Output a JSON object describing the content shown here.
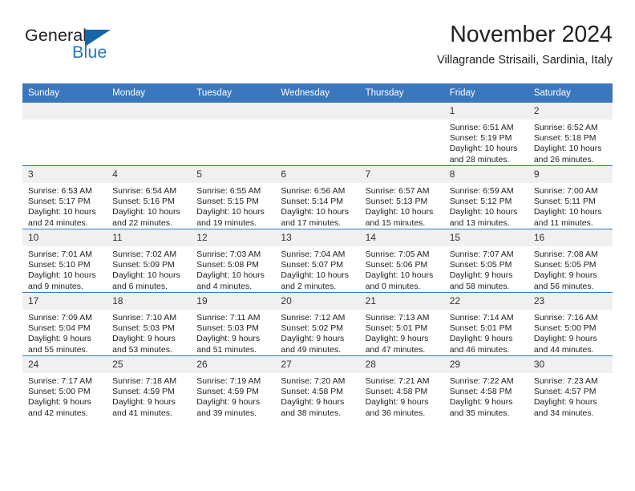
{
  "brand": {
    "name_top": "General",
    "name_bottom": "Blue",
    "color_dark": "#231f20",
    "color_blue": "#2878bd",
    "flag_color": "#1565a8"
  },
  "header": {
    "title": "November 2024",
    "subtitle": "Villagrande Strisaili, Sardinia, Italy"
  },
  "theme": {
    "header_blue": "#3b77bc",
    "daynum_bg": "#f0f0f0",
    "text": "#222222"
  },
  "calendar": {
    "weekday_headers": [
      "Sunday",
      "Monday",
      "Tuesday",
      "Wednesday",
      "Thursday",
      "Friday",
      "Saturday"
    ],
    "weeks": [
      [
        {
          "day": "",
          "blank": true
        },
        {
          "day": "",
          "blank": true
        },
        {
          "day": "",
          "blank": true
        },
        {
          "day": "",
          "blank": true
        },
        {
          "day": "",
          "blank": true
        },
        {
          "day": "1",
          "sunrise": "Sunrise: 6:51 AM",
          "sunset": "Sunset: 5:19 PM",
          "daylight": "Daylight: 10 hours and 28 minutes."
        },
        {
          "day": "2",
          "sunrise": "Sunrise: 6:52 AM",
          "sunset": "Sunset: 5:18 PM",
          "daylight": "Daylight: 10 hours and 26 minutes."
        }
      ],
      [
        {
          "day": "3",
          "sunrise": "Sunrise: 6:53 AM",
          "sunset": "Sunset: 5:17 PM",
          "daylight": "Daylight: 10 hours and 24 minutes."
        },
        {
          "day": "4",
          "sunrise": "Sunrise: 6:54 AM",
          "sunset": "Sunset: 5:16 PM",
          "daylight": "Daylight: 10 hours and 22 minutes."
        },
        {
          "day": "5",
          "sunrise": "Sunrise: 6:55 AM",
          "sunset": "Sunset: 5:15 PM",
          "daylight": "Daylight: 10 hours and 19 minutes."
        },
        {
          "day": "6",
          "sunrise": "Sunrise: 6:56 AM",
          "sunset": "Sunset: 5:14 PM",
          "daylight": "Daylight: 10 hours and 17 minutes."
        },
        {
          "day": "7",
          "sunrise": "Sunrise: 6:57 AM",
          "sunset": "Sunset: 5:13 PM",
          "daylight": "Daylight: 10 hours and 15 minutes."
        },
        {
          "day": "8",
          "sunrise": "Sunrise: 6:59 AM",
          "sunset": "Sunset: 5:12 PM",
          "daylight": "Daylight: 10 hours and 13 minutes."
        },
        {
          "day": "9",
          "sunrise": "Sunrise: 7:00 AM",
          "sunset": "Sunset: 5:11 PM",
          "daylight": "Daylight: 10 hours and 11 minutes."
        }
      ],
      [
        {
          "day": "10",
          "sunrise": "Sunrise: 7:01 AM",
          "sunset": "Sunset: 5:10 PM",
          "daylight": "Daylight: 10 hours and 9 minutes."
        },
        {
          "day": "11",
          "sunrise": "Sunrise: 7:02 AM",
          "sunset": "Sunset: 5:09 PM",
          "daylight": "Daylight: 10 hours and 6 minutes."
        },
        {
          "day": "12",
          "sunrise": "Sunrise: 7:03 AM",
          "sunset": "Sunset: 5:08 PM",
          "daylight": "Daylight: 10 hours and 4 minutes."
        },
        {
          "day": "13",
          "sunrise": "Sunrise: 7:04 AM",
          "sunset": "Sunset: 5:07 PM",
          "daylight": "Daylight: 10 hours and 2 minutes."
        },
        {
          "day": "14",
          "sunrise": "Sunrise: 7:05 AM",
          "sunset": "Sunset: 5:06 PM",
          "daylight": "Daylight: 10 hours and 0 minutes."
        },
        {
          "day": "15",
          "sunrise": "Sunrise: 7:07 AM",
          "sunset": "Sunset: 5:05 PM",
          "daylight": "Daylight: 9 hours and 58 minutes."
        },
        {
          "day": "16",
          "sunrise": "Sunrise: 7:08 AM",
          "sunset": "Sunset: 5:05 PM",
          "daylight": "Daylight: 9 hours and 56 minutes."
        }
      ],
      [
        {
          "day": "17",
          "sunrise": "Sunrise: 7:09 AM",
          "sunset": "Sunset: 5:04 PM",
          "daylight": "Daylight: 9 hours and 55 minutes."
        },
        {
          "day": "18",
          "sunrise": "Sunrise: 7:10 AM",
          "sunset": "Sunset: 5:03 PM",
          "daylight": "Daylight: 9 hours and 53 minutes."
        },
        {
          "day": "19",
          "sunrise": "Sunrise: 7:11 AM",
          "sunset": "Sunset: 5:03 PM",
          "daylight": "Daylight: 9 hours and 51 minutes."
        },
        {
          "day": "20",
          "sunrise": "Sunrise: 7:12 AM",
          "sunset": "Sunset: 5:02 PM",
          "daylight": "Daylight: 9 hours and 49 minutes."
        },
        {
          "day": "21",
          "sunrise": "Sunrise: 7:13 AM",
          "sunset": "Sunset: 5:01 PM",
          "daylight": "Daylight: 9 hours and 47 minutes."
        },
        {
          "day": "22",
          "sunrise": "Sunrise: 7:14 AM",
          "sunset": "Sunset: 5:01 PM",
          "daylight": "Daylight: 9 hours and 46 minutes."
        },
        {
          "day": "23",
          "sunrise": "Sunrise: 7:16 AM",
          "sunset": "Sunset: 5:00 PM",
          "daylight": "Daylight: 9 hours and 44 minutes."
        }
      ],
      [
        {
          "day": "24",
          "sunrise": "Sunrise: 7:17 AM",
          "sunset": "Sunset: 5:00 PM",
          "daylight": "Daylight: 9 hours and 42 minutes."
        },
        {
          "day": "25",
          "sunrise": "Sunrise: 7:18 AM",
          "sunset": "Sunset: 4:59 PM",
          "daylight": "Daylight: 9 hours and 41 minutes."
        },
        {
          "day": "26",
          "sunrise": "Sunrise: 7:19 AM",
          "sunset": "Sunset: 4:59 PM",
          "daylight": "Daylight: 9 hours and 39 minutes."
        },
        {
          "day": "27",
          "sunrise": "Sunrise: 7:20 AM",
          "sunset": "Sunset: 4:58 PM",
          "daylight": "Daylight: 9 hours and 38 minutes."
        },
        {
          "day": "28",
          "sunrise": "Sunrise: 7:21 AM",
          "sunset": "Sunset: 4:58 PM",
          "daylight": "Daylight: 9 hours and 36 minutes."
        },
        {
          "day": "29",
          "sunrise": "Sunrise: 7:22 AM",
          "sunset": "Sunset: 4:58 PM",
          "daylight": "Daylight: 9 hours and 35 minutes."
        },
        {
          "day": "30",
          "sunrise": "Sunrise: 7:23 AM",
          "sunset": "Sunset: 4:57 PM",
          "daylight": "Daylight: 9 hours and 34 minutes."
        }
      ]
    ]
  }
}
